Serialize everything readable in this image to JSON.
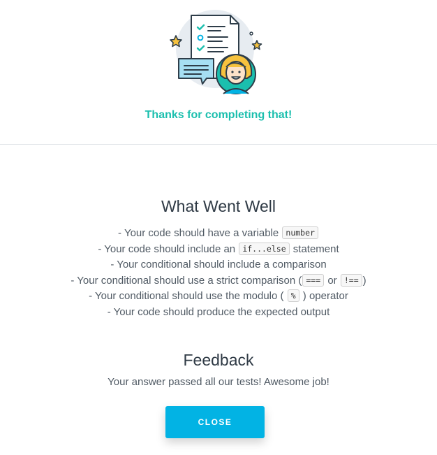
{
  "header": {
    "message": "Thanks for completing that!"
  },
  "what_went_well": {
    "title": "What Went Well",
    "items": [
      {
        "before": "- Your code should have a variable ",
        "code": "number",
        "after": ""
      },
      {
        "before": "- Your code should include an ",
        "code": "if...else",
        "after": " statement"
      },
      {
        "before": "- Your conditional should include a comparison",
        "code": "",
        "after": ""
      },
      {
        "before": "- Your conditional should use a strict comparison (",
        "code": "===",
        "middle": " or ",
        "code2": "!==",
        "after": ")"
      },
      {
        "before": "- Your conditional should use the modulo ( ",
        "code": "%",
        "after": " ) operator"
      },
      {
        "before": "- Your code should produce the expected output",
        "code": "",
        "after": ""
      }
    ]
  },
  "feedback": {
    "title": "Feedback",
    "message": "Your answer passed all our tests! Awesome job!"
  },
  "close_button": {
    "label": "CLOSE"
  },
  "colors": {
    "accent_teal": "#1bbfae",
    "button_blue": "#02b3e4"
  },
  "icons": {
    "illustration": "checklist-with-woman-illustration"
  }
}
